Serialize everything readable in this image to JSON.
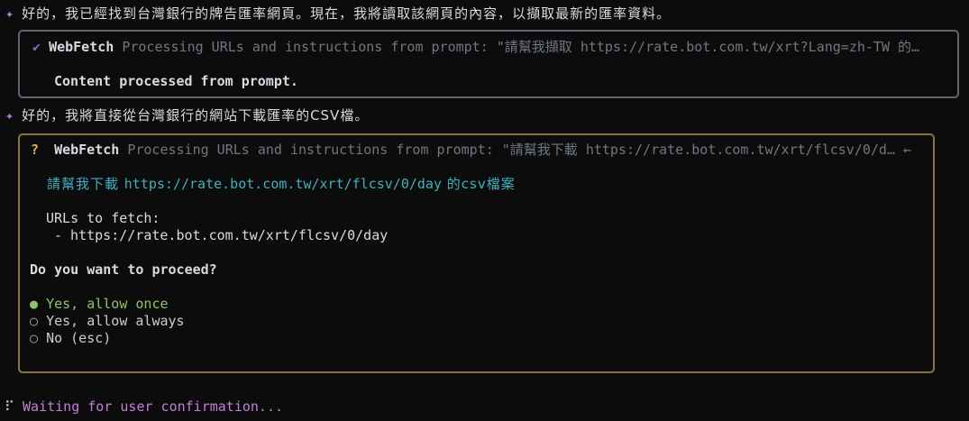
{
  "messages": [
    {
      "icon": "sparkle-icon",
      "text": "好的，我已經找到台灣銀行的牌告匯率網頁。現在，我將讀取該網頁的內容，以擷取最新的匯率資料。"
    },
    {
      "icon": "sparkle-icon",
      "text": "好的，我將直接從台灣銀行的網站下載匯率的CSV檔。"
    }
  ],
  "tool1": {
    "status_icon": "check-icon",
    "name": "WebFetch",
    "description": "Processing URLs and instructions from prompt: \"請幫我擷取 https://rate.bot.com.tw/xrt?Lang=zh-TW 的…",
    "result": "Content processed from prompt."
  },
  "tool2": {
    "status_icon": "question-icon",
    "status_mark": "?",
    "name": "WebFetch",
    "description": "Processing URLs and instructions from prompt: \"請幫我下載 https://rate.bot.com.tw/xrt/flcsv/0/d…",
    "arrow": "←",
    "prompt_prefix": "請幫我下載 ",
    "prompt_url": "https://rate.bot.com.tw/xrt/flcsv/0/day",
    "prompt_suffix": " 的csv檔案",
    "urls_label": "URLs to fetch:",
    "urls": [
      "- https://rate.bot.com.tw/xrt/flcsv/0/day"
    ],
    "question": "Do you want to proceed?",
    "options": [
      {
        "label": "Yes, allow once",
        "selected": true
      },
      {
        "label": "Yes, allow always",
        "selected": false
      },
      {
        "label": "No (esc)",
        "selected": false
      }
    ]
  },
  "status": {
    "spinner": "⠏",
    "text": "Waiting for user confirmation..."
  },
  "colors": {
    "background": "#0c0c0c",
    "accent_purple": "#c47ed9",
    "selected_green": "#8fc36b",
    "link_cyan": "#3fb0c0",
    "permission_border": "#8a7443"
  }
}
